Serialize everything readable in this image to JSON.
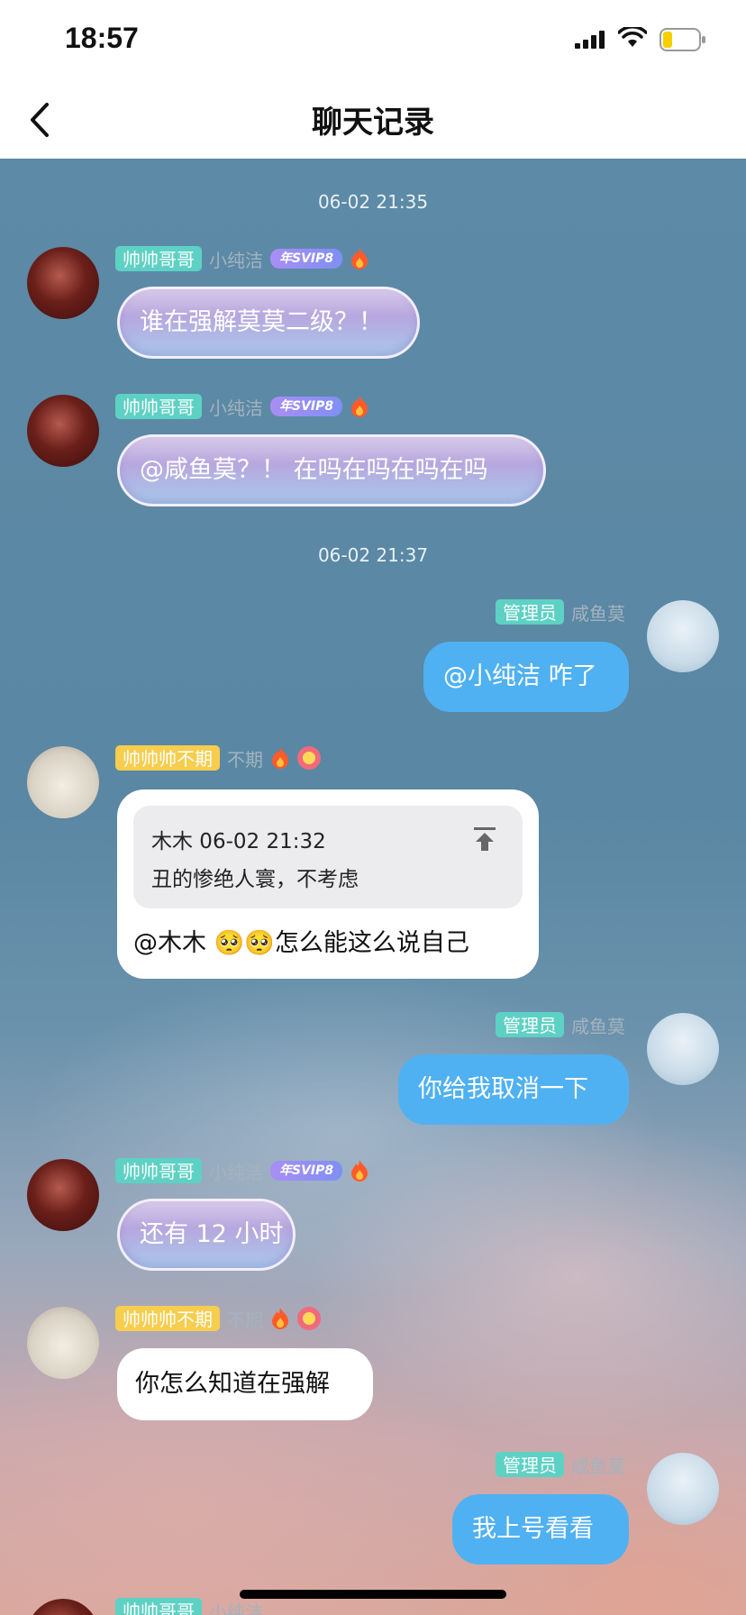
{
  "status_bar": {
    "time": "18:57"
  },
  "nav": {
    "title": "聊天记录"
  },
  "timestamps": [
    "06-02 21:35",
    "06-02 21:37"
  ],
  "users": {
    "shuaige": {
      "tag": "帅帅哥哥",
      "sub_name": "小纯洁",
      "vip": "年SVIP8"
    },
    "buqi": {
      "tag": "帅帅帅不期",
      "sub_name": "不期"
    },
    "admin": {
      "tag": "管理员",
      "name": "咸鱼莫"
    }
  },
  "messages": [
    {
      "sender": "帅帅哥哥",
      "text": "谁在强解莫莫二级？！"
    },
    {
      "sender": "帅帅哥哥",
      "text": "@咸鱼莫？！ 在吗在吗在吗在吗"
    },
    {
      "sender": "咸鱼莫",
      "text": "@小纯洁 咋了"
    },
    {
      "sender": "帅帅帅不期",
      "quote": {
        "author_time": "木木 06-02 21:32",
        "text": "丑的惨绝人寰，不考虑"
      },
      "text": "@木木 🥺🥺怎么能这么说自己"
    },
    {
      "sender": "咸鱼莫",
      "text": "你给我取消一下"
    },
    {
      "sender": "帅帅哥哥",
      "text": "还有 12 小时"
    },
    {
      "sender": "帅帅帅不期",
      "text": "你怎么知道在强解"
    },
    {
      "sender": "咸鱼莫",
      "text": "我上号看看"
    }
  ],
  "colors": {
    "admin_bubble": "#4fb1f2",
    "tag_teal": "#5dd1c4",
    "tag_yellow": "#f6cd4d"
  }
}
